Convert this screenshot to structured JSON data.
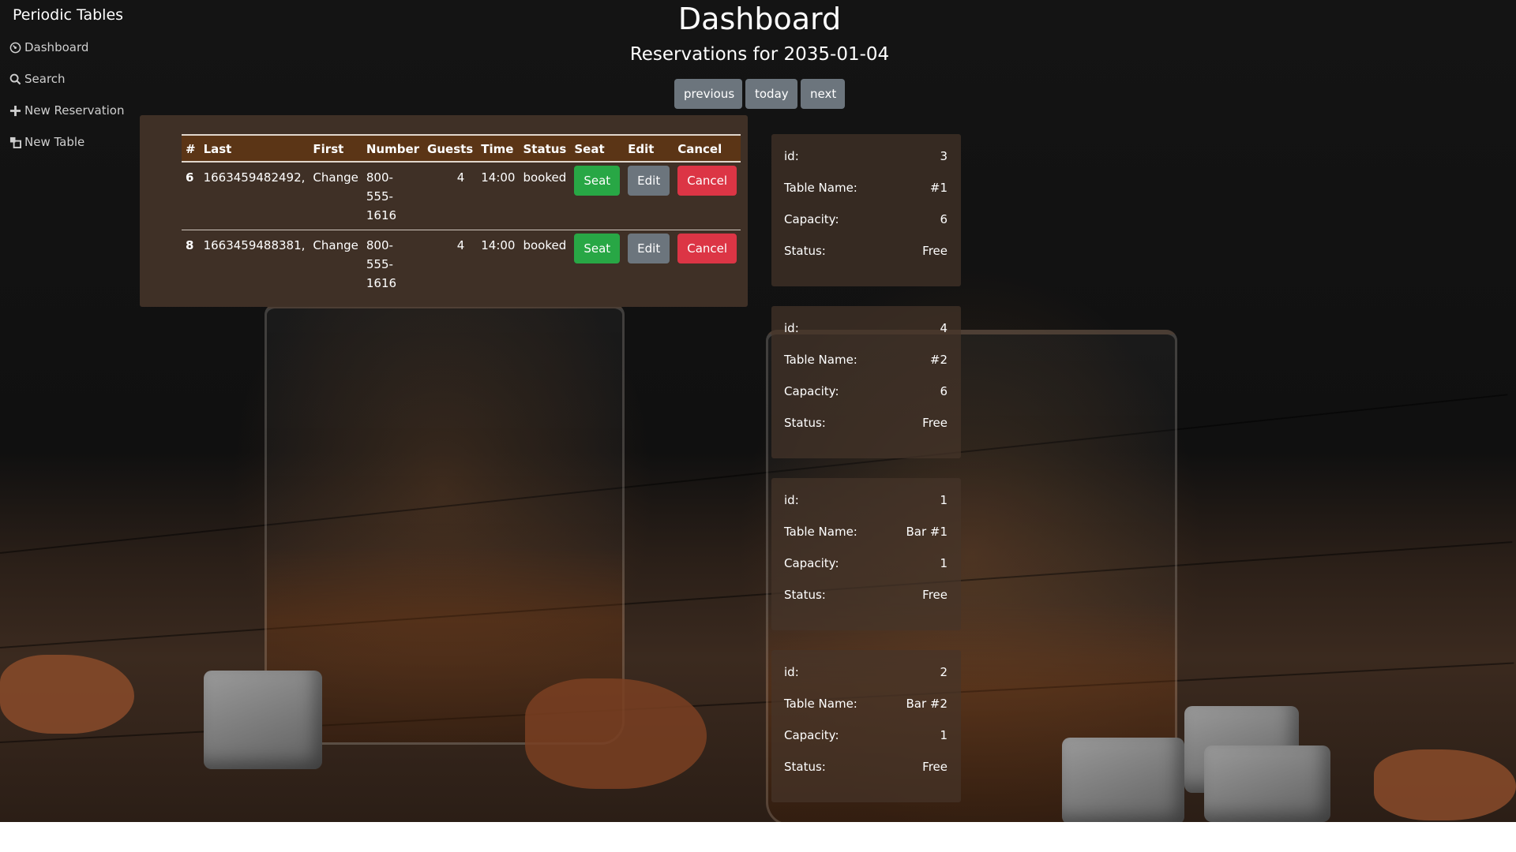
{
  "app": {
    "title": "Periodic Tables"
  },
  "sidebar": {
    "items": [
      {
        "label": "Dashboard",
        "icon": "dashboard-icon"
      },
      {
        "label": "Search",
        "icon": "search-icon"
      },
      {
        "label": "New Reservation",
        "icon": "plus-icon"
      },
      {
        "label": "New Table",
        "icon": "table-icon"
      }
    ]
  },
  "header": {
    "title": "Dashboard",
    "subtitle": "Reservations for 2035-01-04"
  },
  "date_nav": {
    "previous": "previous",
    "today": "today",
    "next": "next"
  },
  "reservations": {
    "columns": [
      "#",
      "Last",
      "First",
      "Number",
      "Guests",
      "Time",
      "Status",
      "Seat",
      "Edit",
      "Cancel"
    ],
    "rows": [
      {
        "id": "6",
        "last": "1663459482492,",
        "first": "Change",
        "number": "800-555-1616",
        "guests": "4",
        "time": "14:00",
        "status": "booked",
        "seat": "Seat",
        "edit": "Edit",
        "cancel": "Cancel"
      },
      {
        "id": "8",
        "last": "1663459488381,",
        "first": "Change",
        "number": "800-555-1616",
        "guests": "4",
        "time": "14:00",
        "status": "booked",
        "seat": "Seat",
        "edit": "Edit",
        "cancel": "Cancel"
      }
    ]
  },
  "tables": {
    "labels": {
      "id": "id:",
      "name": "Table Name:",
      "capacity": "Capacity:",
      "status": "Status:"
    },
    "items": [
      {
        "id": "3",
        "name": "#1",
        "capacity": "6",
        "status": "Free"
      },
      {
        "id": "4",
        "name": "#2",
        "capacity": "6",
        "status": "Free"
      },
      {
        "id": "1",
        "name": "Bar #1",
        "capacity": "1",
        "status": "Free"
      },
      {
        "id": "2",
        "name": "Bar #2",
        "capacity": "1",
        "status": "Free"
      }
    ]
  },
  "colors": {
    "seat": "#28a745",
    "edit": "#6c757d",
    "cancel": "#dc3545",
    "table_header": "#5b3516",
    "panel": "#3f3026"
  }
}
